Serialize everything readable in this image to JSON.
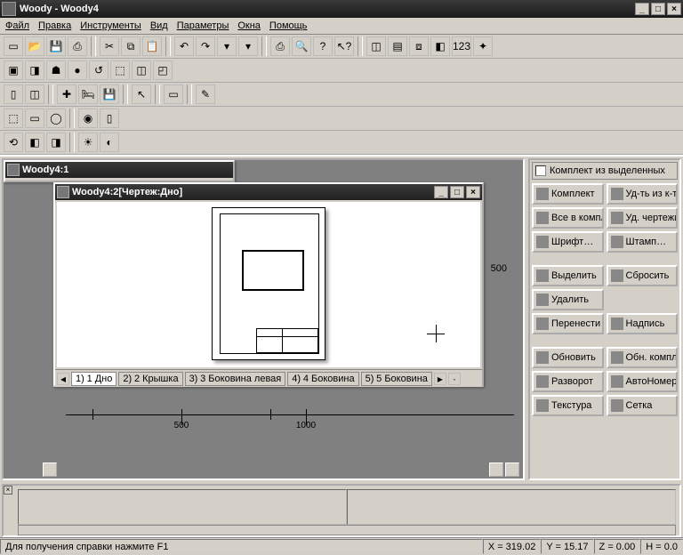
{
  "titlebar": {
    "title": "Woody - Woody4"
  },
  "menu": [
    "Файл",
    "Правка",
    "Инструменты",
    "Вид",
    "Параметры",
    "Окна",
    "Помощь"
  ],
  "mdi1": {
    "title": "Woody4:1"
  },
  "mdi2": {
    "title": "Woody4:2[Чертеж:Дно]"
  },
  "tabs": [
    {
      "n": "1)",
      "label": "1 Дно",
      "active": true
    },
    {
      "n": "2)",
      "label": "2 Крышка"
    },
    {
      "n": "3)",
      "label": "3 Боковина левая"
    },
    {
      "n": "4)",
      "label": "4 Боковина"
    },
    {
      "n": "5)",
      "label": "5 Боковина"
    }
  ],
  "ruler": {
    "labels": [
      "500",
      "1000"
    ],
    "side": "500"
  },
  "side": {
    "header": "Комплект из выделенных",
    "buttons": [
      [
        "Комплект",
        "Уд-ть из к-т"
      ],
      [
        "Все в компл",
        "Уд. чертежи"
      ],
      [
        "Шрифт…",
        "Штамп…"
      ],
      "spacer",
      [
        "Выделить",
        "Сбросить"
      ],
      [
        "Удалить",
        ""
      ],
      [
        "Перенести",
        "Надпись"
      ],
      "spacer",
      [
        "Обновить",
        "Обн. компл"
      ],
      [
        "Разворот",
        "АвтоНомер"
      ],
      [
        "Текстура",
        "Сетка"
      ]
    ]
  },
  "status": {
    "help": "Для получения справки нажмите  F1",
    "x": "X = 319.02",
    "y": "Y = 15.17",
    "z": "Z = 0.00",
    "h": "H = 0.0"
  }
}
